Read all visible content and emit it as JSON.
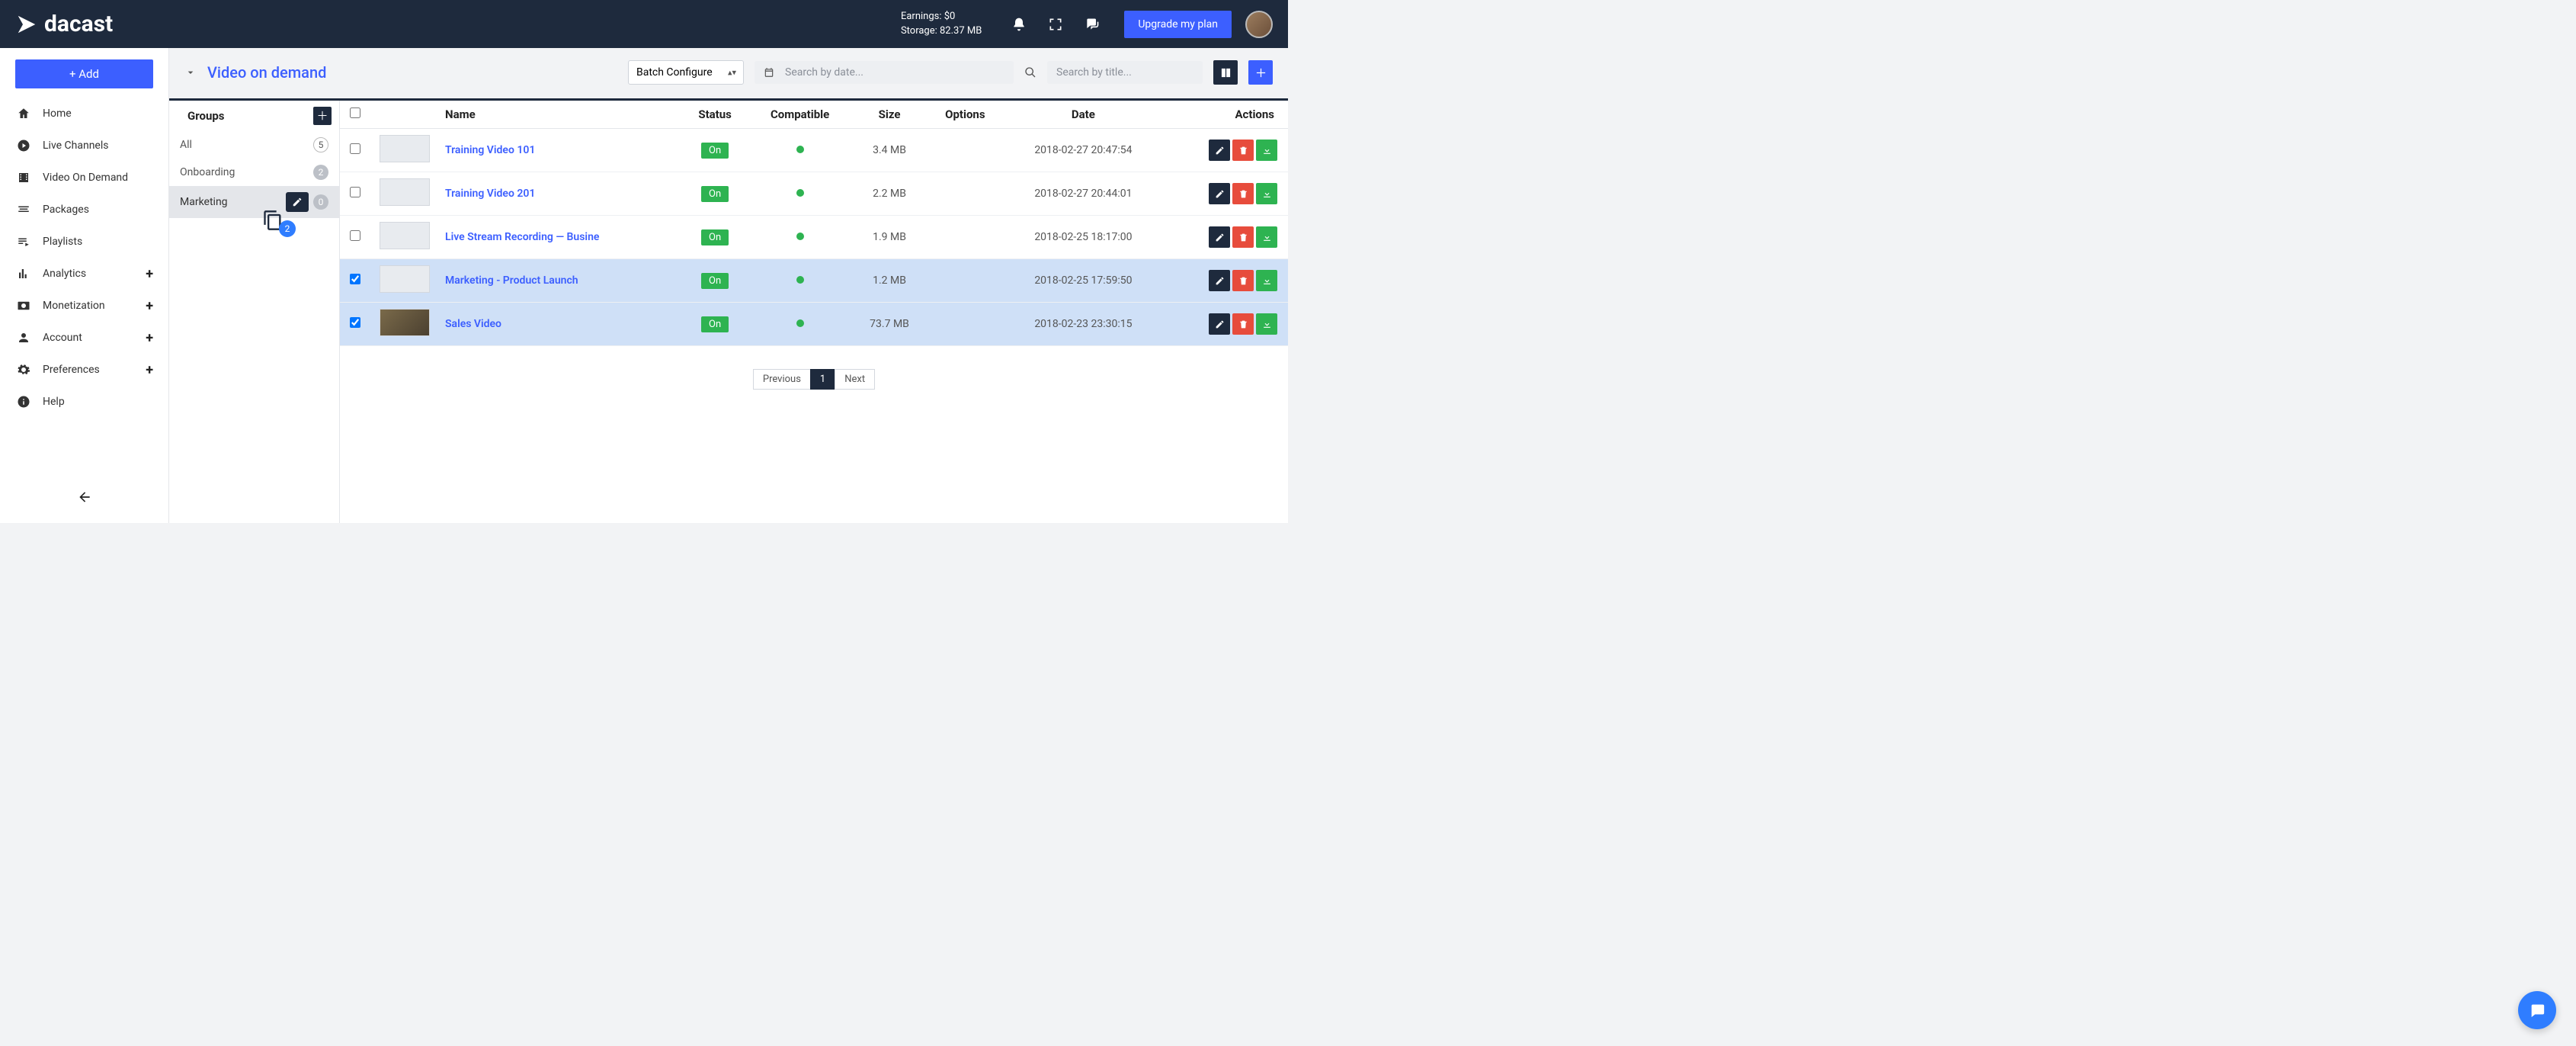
{
  "brand": {
    "name": "dacast"
  },
  "header": {
    "earnings_label": "Earnings: $0",
    "storage_label": "Storage: 82.37 MB",
    "upgrade_label": "Upgrade my plan"
  },
  "sidebar": {
    "add_label": "+ Add",
    "items": [
      {
        "label": "Home",
        "icon": "home"
      },
      {
        "label": "Live Channels",
        "icon": "play"
      },
      {
        "label": "Video On Demand",
        "icon": "film"
      },
      {
        "label": "Packages",
        "icon": "package"
      },
      {
        "label": "Playlists",
        "icon": "playlist"
      },
      {
        "label": "Analytics",
        "icon": "analytics",
        "plus": true
      },
      {
        "label": "Monetization",
        "icon": "money",
        "plus": true
      },
      {
        "label": " Account",
        "icon": "person",
        "plus": true
      },
      {
        "label": "Preferences",
        "icon": "gear",
        "plus": true
      },
      {
        "label": "Help",
        "icon": "info"
      }
    ]
  },
  "page": {
    "title": "Video on demand"
  },
  "toolbar": {
    "batch_label": "Batch Configure"
  },
  "search": {
    "date_placeholder": "Search by date...",
    "title_placeholder": "Search by title..."
  },
  "groups": {
    "header": "Groups",
    "items": [
      {
        "label": "All",
        "count": "5",
        "style": "ring"
      },
      {
        "label": "Onboarding",
        "count": "2",
        "style": "badge"
      },
      {
        "label": "Marketing",
        "count": "0",
        "style": "badge",
        "selected": true
      }
    ]
  },
  "drag": {
    "count": "2"
  },
  "table": {
    "headers": {
      "name": "Name",
      "status": "Status",
      "compatible": "Compatible",
      "size": "Size",
      "options": "Options",
      "date": "Date",
      "actions": "Actions"
    },
    "rows": [
      {
        "checked": false,
        "name": "Training Video 101",
        "status": "On",
        "size": "3.4 MB",
        "date": "2018-02-27 20:47:54"
      },
      {
        "checked": false,
        "name": "Training Video 201",
        "status": "On",
        "size": "2.2 MB",
        "date": "2018-02-27 20:44:01"
      },
      {
        "checked": false,
        "name": "Live Stream Recording — Busine",
        "status": "On",
        "size": "1.9 MB",
        "date": "2018-02-25 18:17:00"
      },
      {
        "checked": true,
        "name": "Marketing - Product Launch",
        "status": "On",
        "size": "1.2 MB",
        "date": "2018-02-25 17:59:50"
      },
      {
        "checked": true,
        "name": "Sales Video",
        "status": "On",
        "size": "73.7 MB",
        "date": "2018-02-23 23:30:15",
        "dark_thumb": true
      }
    ]
  },
  "pagination": {
    "prev": "Previous",
    "current": "1",
    "next": "Next"
  }
}
